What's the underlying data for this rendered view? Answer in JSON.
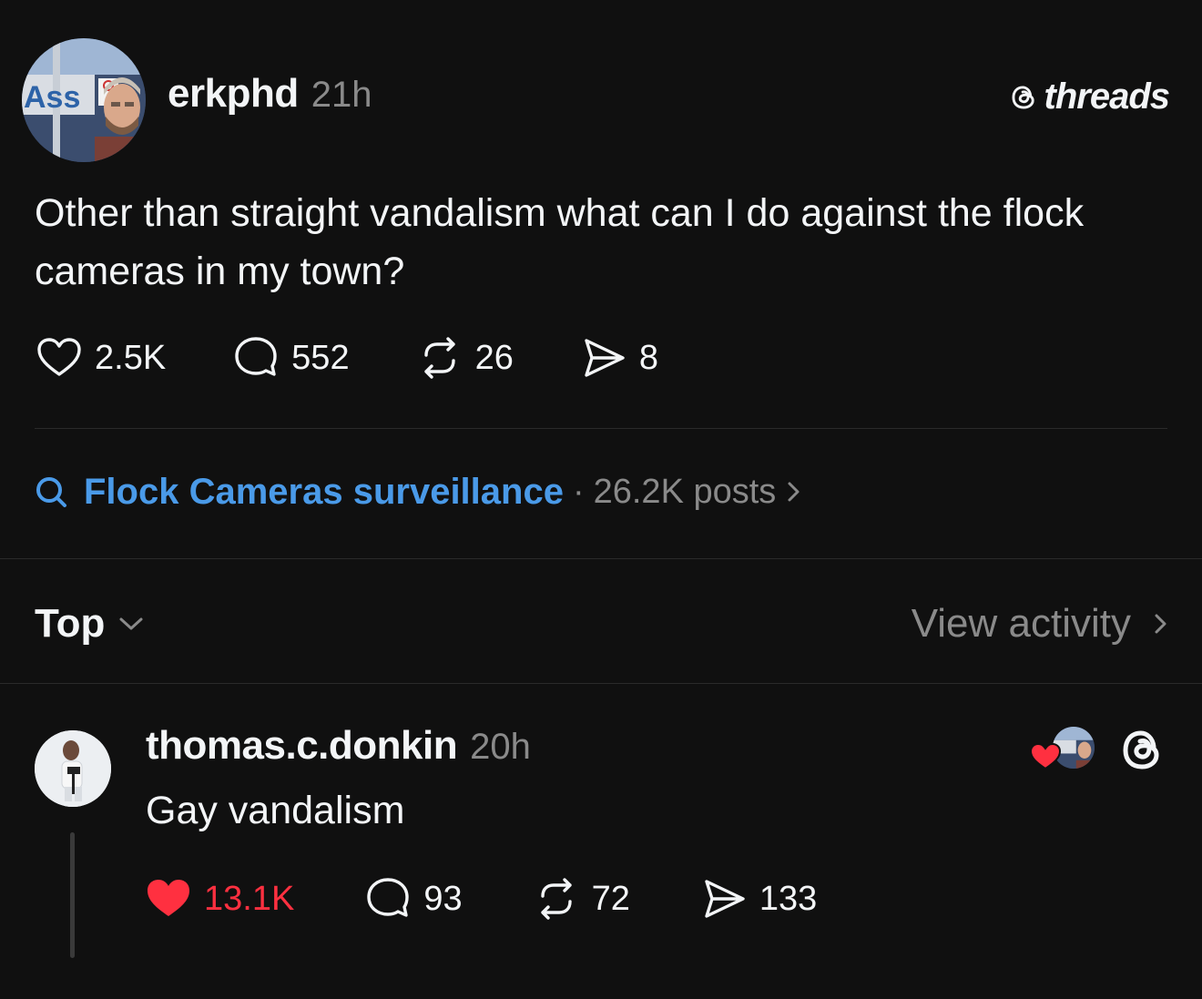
{
  "brand": {
    "name": "threads",
    "icon": "threads-logo-icon"
  },
  "post": {
    "avatar_icon": "avatar",
    "username": "erkphd",
    "time": "21h",
    "text": "Other than straight vandalism what can I do against the flock cameras in my town?",
    "likes": "2.5K",
    "replies": "552",
    "reposts": "26",
    "shares": "8"
  },
  "topic": {
    "icon": "search-icon",
    "name": "Flock Cameras surveillance",
    "separator": "·",
    "count": "26.2K posts"
  },
  "sort": {
    "label": "Top"
  },
  "activity": {
    "label": "View activity"
  },
  "reply": {
    "username": "thomas.c.donkin",
    "time": "20h",
    "text": "Gay vandalism",
    "likes": "13.1K",
    "replies": "93",
    "reposts": "72",
    "shares": "133",
    "liked": true
  },
  "colors": {
    "background": "#101010",
    "text": "#f3f5f7",
    "secondary": "#8a8a8a",
    "link": "#4a9ae8",
    "like": "#ff3040"
  }
}
